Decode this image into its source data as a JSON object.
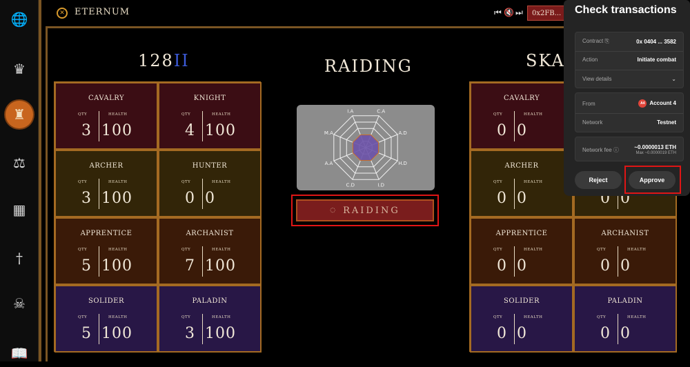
{
  "app": {
    "title": "ETERNUM",
    "logo": "eternum-logo-icon"
  },
  "topbar": {
    "prev_icon": "skip-back-icon",
    "mute_icon": "volume-mute-icon",
    "next_icon": "skip-forward-icon",
    "wallet_chip": "0x2FB..."
  },
  "sidebar": {
    "items": [
      {
        "icon": "globe-icon",
        "glyph": "🌐"
      },
      {
        "icon": "crown-icon",
        "glyph": "♛"
      },
      {
        "icon": "castle-icon",
        "glyph": "♜",
        "active": true
      },
      {
        "icon": "balance-scale-icon",
        "glyph": "⚖"
      },
      {
        "icon": "building-icon",
        "glyph": "▦"
      },
      {
        "icon": "sword-icon",
        "glyph": "†"
      },
      {
        "icon": "skull-crossbones-icon",
        "glyph": "☠"
      },
      {
        "icon": "open-book-icon",
        "glyph": "📖"
      }
    ]
  },
  "left_army": {
    "title": "128",
    "suffix": "II",
    "units": [
      {
        "name": "CAVALRY",
        "qty": "3",
        "health": "100",
        "color": "#3b0d14"
      },
      {
        "name": "KNIGHT",
        "qty": "4",
        "health": "100",
        "color": "#3b0d14"
      },
      {
        "name": "ARCHER",
        "qty": "3",
        "health": "100",
        "color": "#322508"
      },
      {
        "name": "HUNTER",
        "qty": "0",
        "health": "0",
        "color": "#322508"
      },
      {
        "name": "APPRENTICE",
        "qty": "5",
        "health": "100",
        "color": "#3a1a08"
      },
      {
        "name": "ARCHANIST",
        "qty": "7",
        "health": "100",
        "color": "#3a1a08"
      },
      {
        "name": "SOLIDER",
        "qty": "5",
        "health": "100",
        "color": "#281746"
      },
      {
        "name": "PALADIN",
        "qty": "3",
        "health": "100",
        "color": "#281746"
      }
    ]
  },
  "right_army": {
    "title": "SKAR",
    "units": [
      {
        "name": "CAVALRY",
        "qty": "0",
        "health": "0",
        "color": "#3b0d14"
      },
      {
        "name": "",
        "qty": "0",
        "health": "0",
        "color": "#3b0d14"
      },
      {
        "name": "ARCHER",
        "qty": "0",
        "health": "0",
        "color": "#322508"
      },
      {
        "name": "",
        "qty": "0",
        "health": "0",
        "color": "#322508"
      },
      {
        "name": "APPRENTICE",
        "qty": "0",
        "health": "0",
        "color": "#3a1a08"
      },
      {
        "name": "ARCHANIST",
        "qty": "0",
        "health": "0",
        "color": "#3a1a08"
      },
      {
        "name": "SOLIDER",
        "qty": "0",
        "health": "0",
        "color": "#281746"
      },
      {
        "name": "PALADIN",
        "qty": "0",
        "health": "0",
        "color": "#281746"
      }
    ]
  },
  "labels": {
    "qty": "QTY",
    "health": "HEALTH"
  },
  "raid": {
    "title": "RAIDING",
    "button_label": "RAIDING",
    "radar_axes": [
      "C.A",
      "A.D",
      "H.D",
      "I.D",
      "C.D",
      "A.A",
      "M.A",
      "I.A"
    ],
    "radar_color": "#6b52a8"
  },
  "tx": {
    "title": "Check transactions",
    "contract_label": "Contract",
    "contract_value": "0x 0404 ... 3582",
    "action_label": "Action",
    "action_value": "Initiate combat",
    "view_details": "View details",
    "from_label": "From",
    "from_value": "Account 4",
    "avatar_text": "A4",
    "network_label": "Network",
    "network_value": "Testnet",
    "fee_label": "Network fee",
    "fee_value": "~0.0000013 ETH",
    "fee_max": "Max ~0.0000019 ETH",
    "reject_label": "Reject",
    "approve_label": "Approve"
  }
}
